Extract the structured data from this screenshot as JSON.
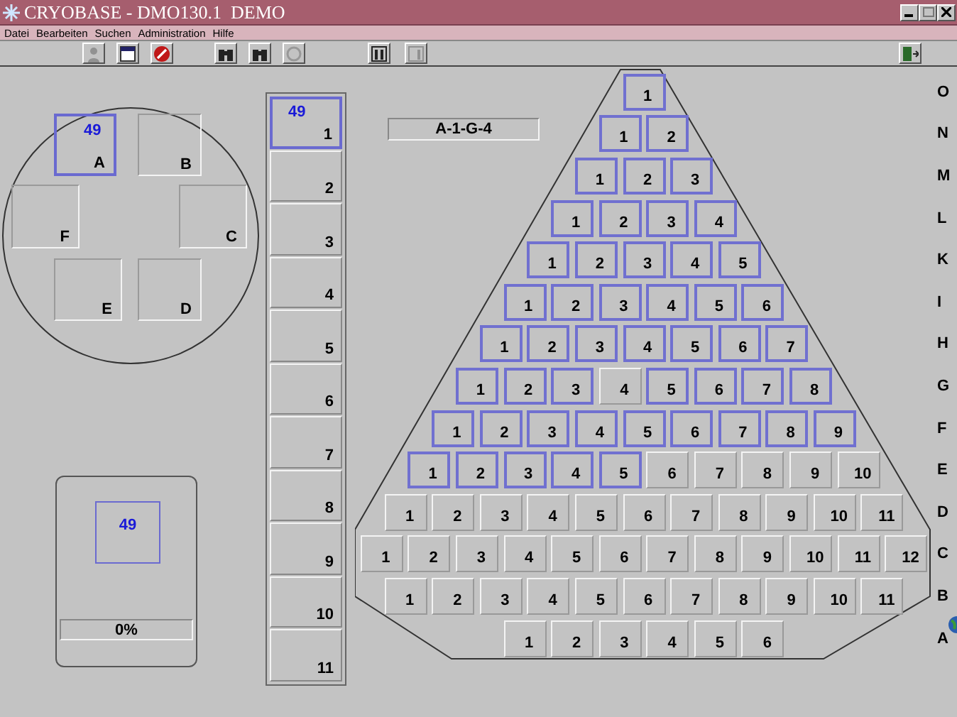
{
  "window": {
    "title": "CRYOBASE - DMO130.1  DEMO"
  },
  "menu": [
    "Datei",
    "Bearbeiten",
    "Suchen",
    "Administration",
    "Hilfe"
  ],
  "toolbar": [
    {
      "disabled": true
    },
    {
      "disabled": false
    },
    {
      "disabled": false
    },
    {
      "disabled": false
    },
    {
      "disabled": false
    },
    {
      "disabled": true
    },
    {
      "disabled": false
    },
    {
      "disabled": true
    },
    {
      "disabled": false
    }
  ],
  "dewar": {
    "slots": [
      {
        "label": "A",
        "selected": true,
        "count": "49"
      },
      {
        "label": "B",
        "selected": false
      },
      {
        "label": "F",
        "selected": false
      },
      {
        "label": "C",
        "selected": false
      },
      {
        "label": "E",
        "selected": false
      },
      {
        "label": "D",
        "selected": false
      }
    ]
  },
  "carrier": {
    "count": "49",
    "progress": {
      "label": "0%",
      "level": 0
    }
  },
  "rack": {
    "slots": [
      {
        "number": "1",
        "selected": true,
        "count": "49"
      },
      {
        "number": "2",
        "selected": false
      },
      {
        "number": "3",
        "selected": false
      },
      {
        "number": "4",
        "selected": false
      },
      {
        "number": "5",
        "selected": false
      },
      {
        "number": "6",
        "selected": false
      },
      {
        "number": "7",
        "selected": false
      },
      {
        "number": "8",
        "selected": false
      },
      {
        "number": "9",
        "selected": false
      },
      {
        "number": "10",
        "selected": false
      },
      {
        "number": "11",
        "selected": false
      }
    ]
  },
  "location": "A-1-G-4",
  "box": {
    "rows": [
      {
        "label": "O",
        "cells": [
          {
            "number": "1",
            "selected": true
          }
        ]
      },
      {
        "label": "N",
        "cells": [
          {
            "number": "1",
            "selected": true
          },
          {
            "number": "2",
            "selected": true
          }
        ]
      },
      {
        "label": "M",
        "cells": [
          {
            "number": "1",
            "selected": true
          },
          {
            "number": "2",
            "selected": true
          },
          {
            "number": "3",
            "selected": true
          }
        ]
      },
      {
        "label": "L",
        "cells": [
          {
            "number": "1",
            "selected": true
          },
          {
            "number": "2",
            "selected": true
          },
          {
            "number": "3",
            "selected": true
          },
          {
            "number": "4",
            "selected": true
          }
        ]
      },
      {
        "label": "K",
        "cells": [
          {
            "number": "1",
            "selected": true
          },
          {
            "number": "2",
            "selected": true
          },
          {
            "number": "3",
            "selected": true
          },
          {
            "number": "4",
            "selected": true
          },
          {
            "number": "5",
            "selected": true
          }
        ]
      },
      {
        "label": "I",
        "cells": [
          {
            "number": "1",
            "selected": true
          },
          {
            "number": "2",
            "selected": true
          },
          {
            "number": "3",
            "selected": true
          },
          {
            "number": "4",
            "selected": true
          },
          {
            "number": "5",
            "selected": true
          },
          {
            "number": "6",
            "selected": true
          }
        ]
      },
      {
        "label": "H",
        "cells": [
          {
            "number": "1",
            "selected": true
          },
          {
            "number": "2",
            "selected": true
          },
          {
            "number": "3",
            "selected": true
          },
          {
            "number": "4",
            "selected": true
          },
          {
            "number": "5",
            "selected": true
          },
          {
            "number": "6",
            "selected": true
          },
          {
            "number": "7",
            "selected": true
          }
        ]
      },
      {
        "label": "G",
        "cells": [
          {
            "number": "1",
            "selected": true
          },
          {
            "number": "2",
            "selected": true
          },
          {
            "number": "3",
            "selected": true
          },
          {
            "number": "4",
            "selected": false
          },
          {
            "number": "5",
            "selected": true
          },
          {
            "number": "6",
            "selected": true
          },
          {
            "number": "7",
            "selected": true
          },
          {
            "number": "8",
            "selected": true
          }
        ]
      },
      {
        "label": "F",
        "cells": [
          {
            "number": "1",
            "selected": true
          },
          {
            "number": "2",
            "selected": true
          },
          {
            "number": "3",
            "selected": true
          },
          {
            "number": "4",
            "selected": true
          },
          {
            "number": "5",
            "selected": true
          },
          {
            "number": "6",
            "selected": true
          },
          {
            "number": "7",
            "selected": true
          },
          {
            "number": "8",
            "selected": true
          },
          {
            "number": "9",
            "selected": true
          }
        ]
      },
      {
        "label": "E",
        "cells": [
          {
            "number": "1",
            "selected": true
          },
          {
            "number": "2",
            "selected": true
          },
          {
            "number": "3",
            "selected": true
          },
          {
            "number": "4",
            "selected": true
          },
          {
            "number": "5",
            "selected": true
          },
          {
            "number": "6",
            "selected": false
          },
          {
            "number": "7",
            "selected": false
          },
          {
            "number": "8",
            "selected": false
          },
          {
            "number": "9",
            "selected": false
          },
          {
            "number": "10",
            "selected": false
          }
        ]
      },
      {
        "label": "D",
        "cells": [
          {
            "number": "1",
            "selected": false
          },
          {
            "number": "2",
            "selected": false
          },
          {
            "number": "3",
            "selected": false
          },
          {
            "number": "4",
            "selected": false
          },
          {
            "number": "5",
            "selected": false
          },
          {
            "number": "6",
            "selected": false
          },
          {
            "number": "7",
            "selected": false
          },
          {
            "number": "8",
            "selected": false
          },
          {
            "number": "9",
            "selected": false
          },
          {
            "number": "10",
            "selected": false
          },
          {
            "number": "11",
            "selected": false
          }
        ]
      },
      {
        "label": "C",
        "cells": [
          {
            "number": "1",
            "selected": false
          },
          {
            "number": "2",
            "selected": false
          },
          {
            "number": "3",
            "selected": false
          },
          {
            "number": "4",
            "selected": false
          },
          {
            "number": "5",
            "selected": false
          },
          {
            "number": "6",
            "selected": false
          },
          {
            "number": "7",
            "selected": false
          },
          {
            "number": "8",
            "selected": false
          },
          {
            "number": "9",
            "selected": false
          },
          {
            "number": "10",
            "selected": false
          },
          {
            "number": "11",
            "selected": false
          },
          {
            "number": "12",
            "selected": false
          }
        ]
      },
      {
        "label": "B",
        "cells": [
          {
            "number": "1",
            "selected": false
          },
          {
            "number": "2",
            "selected": false
          },
          {
            "number": "3",
            "selected": false
          },
          {
            "number": "4",
            "selected": false
          },
          {
            "number": "5",
            "selected": false
          },
          {
            "number": "6",
            "selected": false
          },
          {
            "number": "7",
            "selected": false
          },
          {
            "number": "8",
            "selected": false
          },
          {
            "number": "9",
            "selected": false
          },
          {
            "number": "10",
            "selected": false
          },
          {
            "number": "11",
            "selected": false
          }
        ]
      },
      {
        "label": "A",
        "cells": [
          {
            "number": "1",
            "selected": false
          },
          {
            "number": "2",
            "selected": false
          },
          {
            "number": "3",
            "selected": false
          },
          {
            "number": "4",
            "selected": false
          },
          {
            "number": "5",
            "selected": false
          },
          {
            "number": "6",
            "selected": false
          }
        ]
      }
    ]
  }
}
